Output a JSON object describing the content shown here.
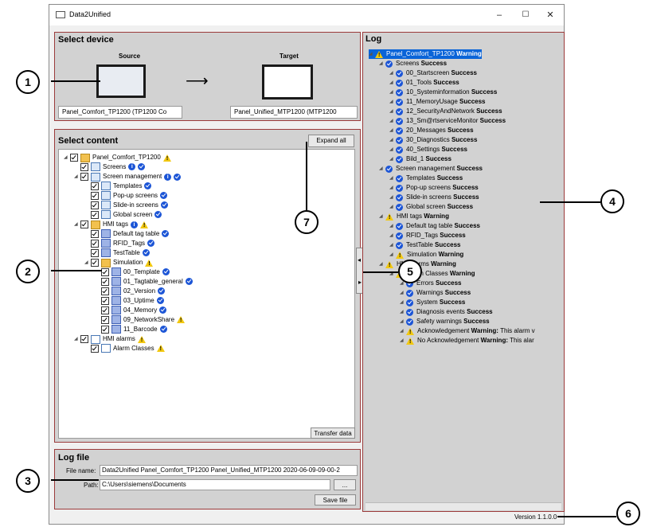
{
  "window": {
    "title": "Data2Unified",
    "min": "–",
    "max": "☐",
    "close": "✕"
  },
  "select_device": {
    "title": "Select device",
    "source_label": "Source",
    "target_label": "Target",
    "source_value": "Panel_Comfort_TP1200 (TP1200 Co",
    "target_value": "Panel_Unified_MTP1200 (MTP1200",
    "arrow": "⟶"
  },
  "select_content": {
    "title": "Select content",
    "expand_all": "Expand all",
    "transfer": "Transfer data",
    "tree": [
      {
        "label": "Panel_Comfort_TP1200",
        "status": "warn"
      },
      {
        "label": "Screens",
        "status": "info-ok"
      },
      {
        "label": "Screen management",
        "status": "info-ok"
      },
      {
        "label": "Templates",
        "status": "ok"
      },
      {
        "label": "Pop-up screens",
        "status": "ok"
      },
      {
        "label": "Slide-in screens",
        "status": "ok"
      },
      {
        "label": "Global screen",
        "status": "ok"
      },
      {
        "label": "HMI tags",
        "status": "info-warn"
      },
      {
        "label": "Default tag table",
        "status": "ok"
      },
      {
        "label": "RFID_Tags",
        "status": "ok"
      },
      {
        "label": "TestTable",
        "status": "ok"
      },
      {
        "label": "Simulation",
        "status": "warn"
      },
      {
        "label": "00_Template",
        "status": "ok"
      },
      {
        "label": "01_Tagtable_general",
        "status": "ok"
      },
      {
        "label": "02_Version",
        "status": "ok"
      },
      {
        "label": "03_Uptime",
        "status": "ok"
      },
      {
        "label": "04_Memory",
        "status": "ok"
      },
      {
        "label": "09_NetworkShare",
        "status": "warn"
      },
      {
        "label": "11_Barcode",
        "status": "ok"
      },
      {
        "label": "HMI alarms",
        "status": "warn"
      },
      {
        "label": "Alarm Classes",
        "status": "warn"
      }
    ]
  },
  "log_file": {
    "title": "Log file",
    "file_name_label": "File name:",
    "file_name_value": "Data2Unified Panel_Comfort_TP1200 Panel_Unified_MTP1200 2020-06-09-09-00-2",
    "path_label": "Path:",
    "path_value": "C:\\Users\\siemens\\Documents",
    "browse": "...",
    "save": "Save file"
  },
  "log": {
    "title": "Log",
    "rows": [
      {
        "name": "Panel_Comfort_TP1200",
        "status": "Warning",
        "icon": "warn"
      },
      {
        "name": "Screens",
        "status": "Success",
        "icon": "ok"
      },
      {
        "name": "00_Startscreen",
        "status": "Success",
        "icon": "ok"
      },
      {
        "name": "01_Tools",
        "status": "Success",
        "icon": "ok"
      },
      {
        "name": "10_Systeminformation",
        "status": "Success",
        "icon": "ok"
      },
      {
        "name": "11_MemoryUsage",
        "status": "Success",
        "icon": "ok"
      },
      {
        "name": "12_SecurityAndNetwork",
        "status": "Success",
        "icon": "ok"
      },
      {
        "name": "13_Sm@rtserviceMonitor",
        "status": "Success",
        "icon": "ok"
      },
      {
        "name": "20_Messages",
        "status": "Success",
        "icon": "ok"
      },
      {
        "name": "30_Diagnostics",
        "status": "Success",
        "icon": "ok"
      },
      {
        "name": "40_Settings",
        "status": "Success",
        "icon": "ok"
      },
      {
        "name": "Bild_1",
        "status": "Success",
        "icon": "ok"
      },
      {
        "name": "Screen management",
        "status": "Success",
        "icon": "ok"
      },
      {
        "name": "Templates",
        "status": "Success",
        "icon": "ok"
      },
      {
        "name": "Pop-up screens",
        "status": "Success",
        "icon": "ok"
      },
      {
        "name": "Slide-in screens",
        "status": "Success",
        "icon": "ok"
      },
      {
        "name": "Global screen",
        "status": "Success",
        "icon": "ok"
      },
      {
        "name": "HMI tags",
        "status": "Warning",
        "icon": "warn"
      },
      {
        "name": "Default tag table",
        "status": "Success",
        "icon": "ok"
      },
      {
        "name": "RFID_Tags",
        "status": "Success",
        "icon": "ok"
      },
      {
        "name": "TestTable",
        "status": "Success",
        "icon": "ok"
      },
      {
        "name": "Simulation",
        "status": "Warning",
        "icon": "warn"
      },
      {
        "name": "HMI alarms",
        "status": "Warning",
        "icon": "warn"
      },
      {
        "name": "Alarm Classes",
        "status": "Warning",
        "icon": "warn"
      },
      {
        "name": "Errors",
        "status": "Success",
        "icon": "ok"
      },
      {
        "name": "Warnings",
        "status": "Success",
        "icon": "ok"
      },
      {
        "name": "System",
        "status": "Success",
        "icon": "ok"
      },
      {
        "name": "Diagnosis events",
        "status": "Success",
        "icon": "ok"
      },
      {
        "name": "Safety warnings",
        "status": "Success",
        "icon": "ok"
      },
      {
        "name": "Acknowledgement",
        "status": "Warning:",
        "extra": "This alarm v",
        "icon": "warn"
      },
      {
        "name": "No Acknowledgement",
        "status": "Warning:",
        "extra": "This alar",
        "icon": "warn"
      }
    ]
  },
  "splitter": {
    "left": "◂",
    "right": "▸"
  },
  "version": "Version 1.1.0.0",
  "callouts": [
    "1",
    "2",
    "3",
    "4",
    "5",
    "6",
    "7"
  ],
  "colors": {
    "panel_border": "#9b3a3a",
    "accent": "#1c55d6",
    "warning": "#f2c811",
    "selection": "#0a64d8"
  }
}
